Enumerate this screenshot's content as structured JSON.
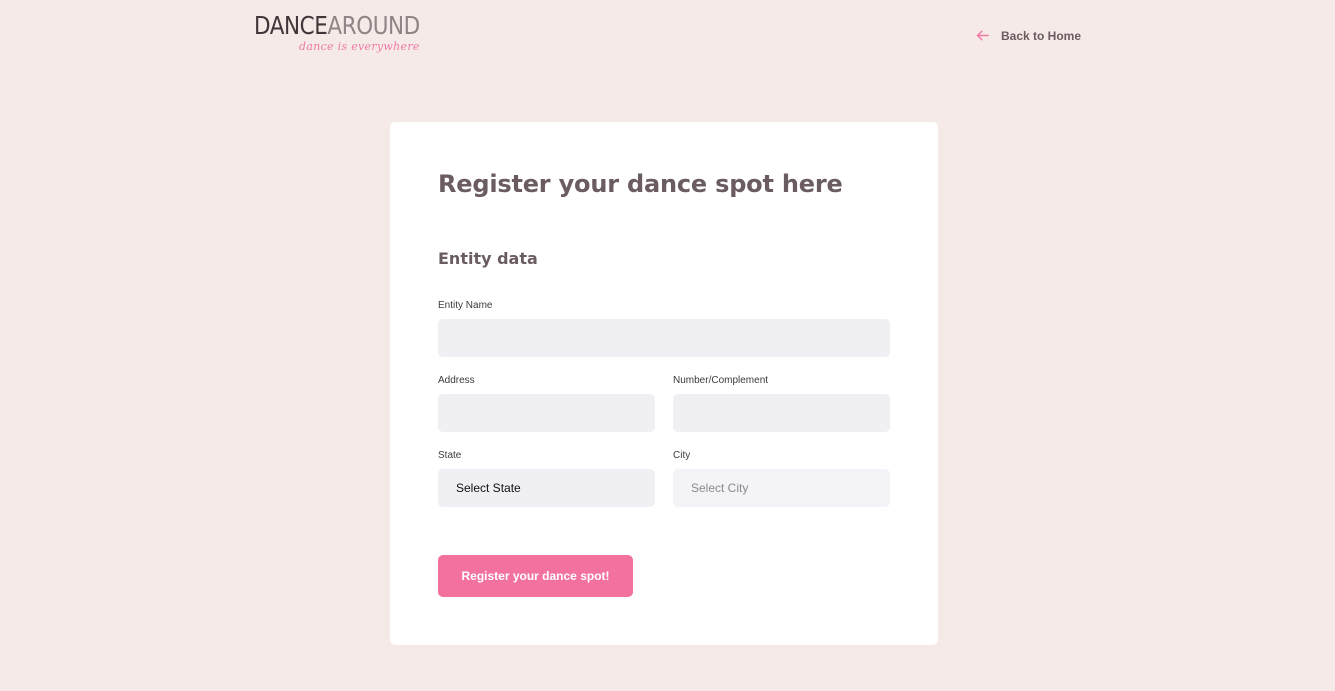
{
  "header": {
    "logo_dance": "DANCE",
    "logo_around": "AROUND",
    "logo_tagline": "dance is everywhere",
    "back_icon": "arrow-left-icon",
    "back_label": "Back to Home"
  },
  "form": {
    "title": "Register your dance spot here",
    "section_title": "Entity data",
    "fields": {
      "entity_name": {
        "label": "Entity Name",
        "value": "",
        "placeholder": ""
      },
      "address": {
        "label": "Address",
        "value": "",
        "placeholder": ""
      },
      "number_complement": {
        "label": "Number/Complement",
        "value": "",
        "placeholder": ""
      },
      "state": {
        "label": "State",
        "selected": "Select State"
      },
      "city": {
        "label": "City",
        "selected": "Select City"
      }
    },
    "submit_label": "Register your dance spot!"
  },
  "colors": {
    "page_background": "#f5eae8",
    "card_background": "#ffffff",
    "input_background": "#f0eff4",
    "accent": "#f3719f",
    "heading_text": "#6a5c60"
  }
}
